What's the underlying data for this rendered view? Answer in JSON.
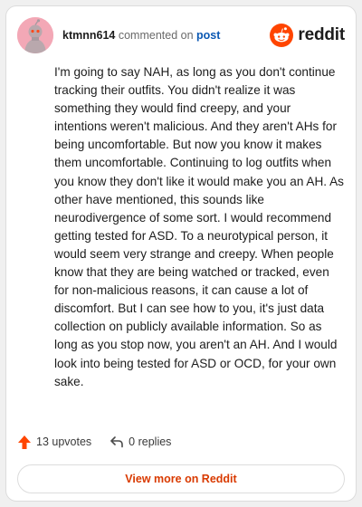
{
  "header": {
    "username": "ktmnn614",
    "action_text": "commented on",
    "post_link": "post",
    "brand": "reddit"
  },
  "comment": {
    "text": "I'm going to say NAH, as long as you don't continue tracking their outfits. You didn't realize it was something they would find creepy, and your intentions weren't malicious. And they aren't AHs for being uncomfortable. But now you know it makes them uncomfortable. Continuing to log outfits when you know they don't like it would make you an AH. As other have mentioned, this sounds like neurodivergence of some sort. I would recommend getting tested for ASD. To a neurotypical person, it would seem very strange and creepy. When people know that they are being watched or tracked, even for non-malicious reasons, it can cause a lot of discomfort. But I can see how to you, it's just data collection on publicly available information. So as long as you stop now, you aren't an AH. And I would look into being tested for ASD or OCD, for your own sake."
  },
  "actions": {
    "upvotes": "13 upvotes",
    "replies": "0 replies"
  },
  "footer": {
    "view_more": "View more on Reddit"
  },
  "icons": {
    "avatar": "snoo-avatar-icon",
    "brand": "reddit-logo-icon",
    "upvote": "upvote-arrow-icon",
    "reply": "reply-arrow-icon"
  },
  "colors": {
    "brand_orange": "#ff4500",
    "link_blue": "#0b58b3",
    "view_more": "#d93a00",
    "avatar_bg": "#f3a8b6"
  }
}
